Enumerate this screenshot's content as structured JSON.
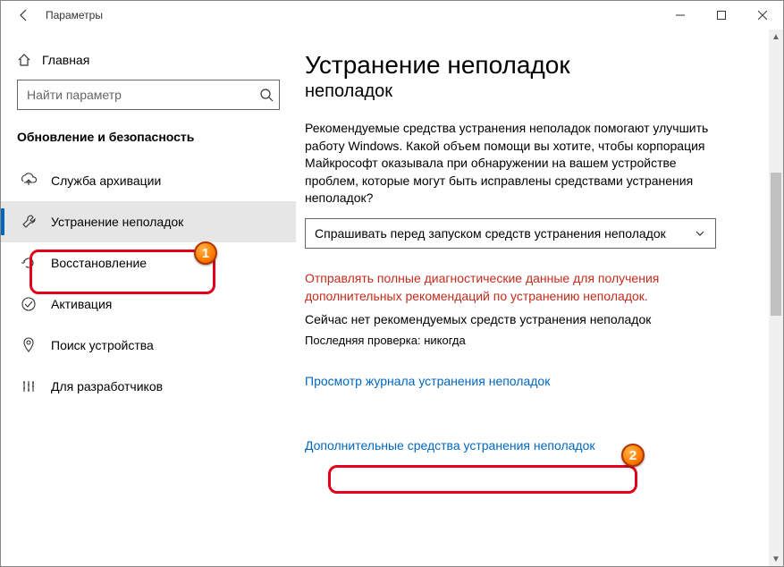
{
  "titlebar": {
    "title": "Параметры"
  },
  "sidebar": {
    "home": "Главная",
    "search_placeholder": "Найти параметр",
    "section": "Обновление и безопасность",
    "items": [
      {
        "label": "Служба архивации"
      },
      {
        "label": "Устранение неполадок"
      },
      {
        "label": "Восстановление"
      },
      {
        "label": "Активация"
      },
      {
        "label": "Поиск устройства"
      },
      {
        "label": "Для разработчиков"
      }
    ]
  },
  "content": {
    "h1": "Устранение неполадок",
    "sub": "неполадок",
    "intro": "Рекомендуемые средства устранения неполадок помогают улучшить работу Windows. Какой объем помощи вы хотите, чтобы корпорация Майкрософт оказывала при обнаружении на вашем устройстве проблем, которые могут быть исправлены средствами устранения неполадок?",
    "select_label": "Спрашивать перед запуском средств устранения неполадок",
    "warn": "Отправлять полные диагностические данные для получения дополнительных рекомендаций по устранению неполадок.",
    "none": "Сейчас нет рекомендуемых средств устранения неполадок",
    "lastcheck": "Последняя проверка: никогда",
    "link1": "Просмотр журнала устранения неполадок",
    "link2": "Дополнительные средства устранения неполадок"
  },
  "badges": {
    "b1": "1",
    "b2": "2"
  }
}
